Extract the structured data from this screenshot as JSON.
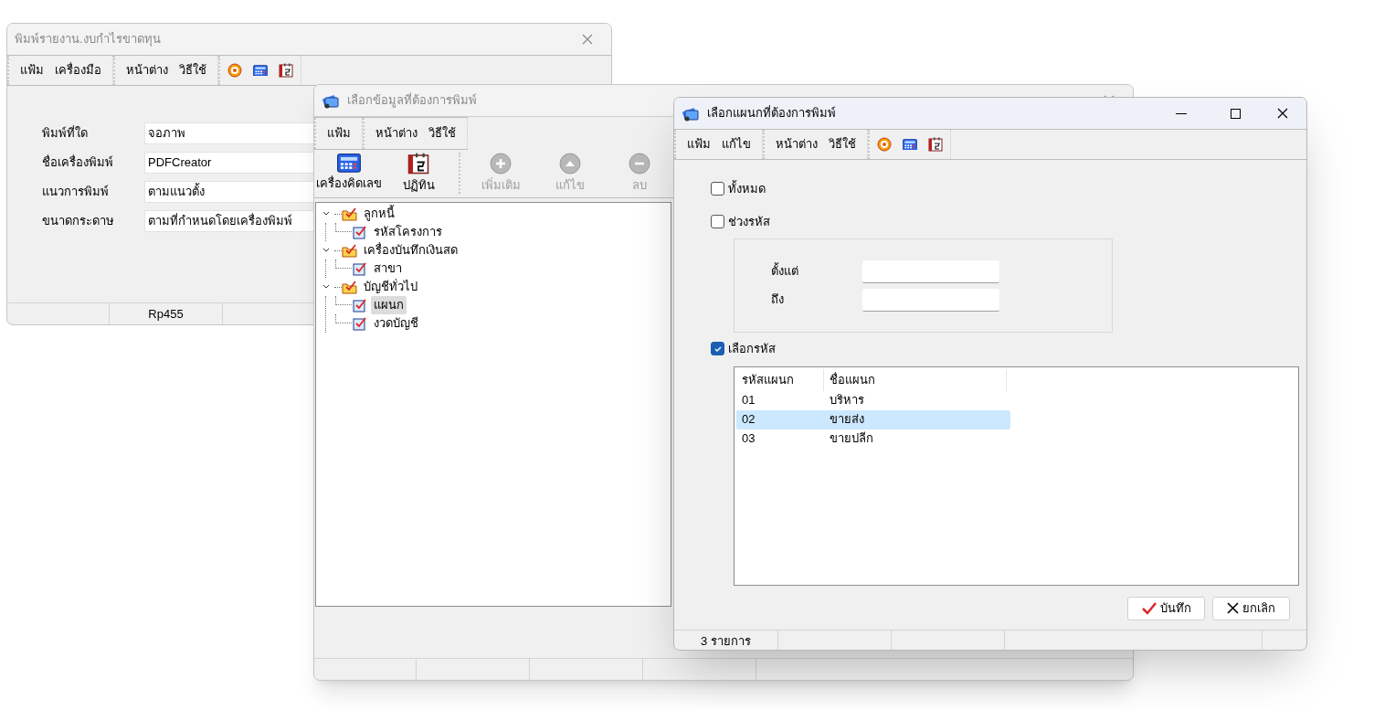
{
  "windows": [
    {
      "title": "พิมพ์รายงาน.งบกำไรขาดทุน",
      "active": false,
      "menu_groups": [
        [
          "แฟ้ม",
          "เครื่องมือ"
        ],
        [
          "หน้าต่าง",
          "วิธีใช้"
        ]
      ],
      "fields": [
        {
          "label": "พิมพ์ที่ใด",
          "value": "จอภาพ"
        },
        {
          "label": "ชื่อเครื่องพิมพ์",
          "value": "PDFCreator"
        },
        {
          "label": "แนวการพิมพ์",
          "value": "ตามแนวตั้ง"
        },
        {
          "label": "ขนาดกระดาษ",
          "value": "ตามที่กำหนดโดยเครื่องพิมพ์"
        }
      ],
      "status_text": "Rp455"
    },
    {
      "title": "เลือกข้อมูลที่ต้องการพิมพ์",
      "active": false,
      "menu_groups": [
        [
          "แฟ้ม"
        ],
        [
          "หน้าต่าง",
          "วิธีใช้"
        ]
      ],
      "toolbar": [
        {
          "label": "เครื่องคิดเลข",
          "kind": "calculator",
          "disabled": false
        },
        {
          "label": "ปฏิทิน",
          "kind": "calendar",
          "disabled": false
        },
        {
          "label": "เพิ่มเติม",
          "kind": "add",
          "disabled": true
        },
        {
          "label": "แก้ไข",
          "kind": "edit",
          "disabled": true
        },
        {
          "label": "ลบ",
          "kind": "delete",
          "disabled": true
        }
      ],
      "tree": [
        {
          "label": "ลูกหนี้",
          "expanded": true,
          "children": [
            {
              "label": "รหัสโครงการ",
              "selected": false
            }
          ]
        },
        {
          "label": "เครื่องบันทึกเงินสด",
          "expanded": true,
          "children": [
            {
              "label": "สาขา",
              "selected": false
            }
          ]
        },
        {
          "label": "บัญชีทั่วไป",
          "expanded": true,
          "children": [
            {
              "label": "แผนก",
              "selected": true
            },
            {
              "label": "งวดบัญชี",
              "selected": false
            }
          ]
        }
      ]
    },
    {
      "title": "เลือกแผนกที่ต้องการพิมพ์",
      "active": true,
      "menu_groups": [
        [
          "แฟ้ม",
          "แก้ไข"
        ],
        [
          "หน้าต่าง",
          "วิธีใช้"
        ]
      ],
      "options": [
        {
          "label": "ทั้งหมด",
          "checked": false
        },
        {
          "label": "ช่วงรหัส",
          "checked": false
        },
        {
          "label": "เลือกรหัส",
          "checked": true
        }
      ],
      "range_fields": [
        {
          "label": "ตั้งแต่"
        },
        {
          "label": "ถึง"
        }
      ],
      "table": {
        "columns": [
          "รหัสแผนก",
          "ชื่อแผนก"
        ],
        "rows": [
          {
            "cells": [
              "01",
              "บริหาร"
            ],
            "selected": false
          },
          {
            "cells": [
              "02",
              "ขายส่ง"
            ],
            "selected": true
          },
          {
            "cells": [
              "03",
              "ขายปลีก"
            ],
            "selected": false
          }
        ]
      },
      "buttons": [
        {
          "label": "บันทึก",
          "kind": "save"
        },
        {
          "label": "ยกเลิก",
          "kind": "cancel"
        }
      ],
      "status_text": "3 รายการ"
    }
  ]
}
